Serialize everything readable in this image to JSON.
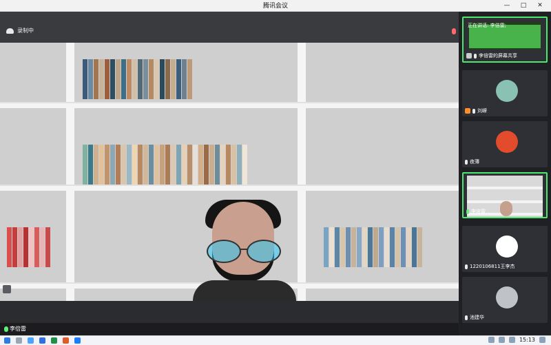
{
  "window": {
    "title": "腾讯会议",
    "minimize_glyph": "—",
    "maximize_glyph": "□",
    "close_glyph": "✕"
  },
  "stage": {
    "recording_label": "录制中",
    "speaker_name": "李倍雷"
  },
  "panel": {
    "now_speaking": "正在讲话: 李倍雷;",
    "tiles": [
      {
        "name": "李倍雷的屏幕共享"
      },
      {
        "name": "刘嵘"
      },
      {
        "name": "夜薄"
      },
      {
        "name": "李倍雷"
      },
      {
        "name": "1220106811王李杰"
      },
      {
        "name": "池建华"
      }
    ]
  },
  "taskbar": {
    "time": "15:13"
  },
  "colors": {
    "active_border": "#4fe76e",
    "recording_mic": "#ff6a6a",
    "mic_green": "#5ff07a"
  },
  "icons": {
    "recording": "cloud-record-icon",
    "mic": "mic-icon",
    "windows": "windows-icon"
  }
}
